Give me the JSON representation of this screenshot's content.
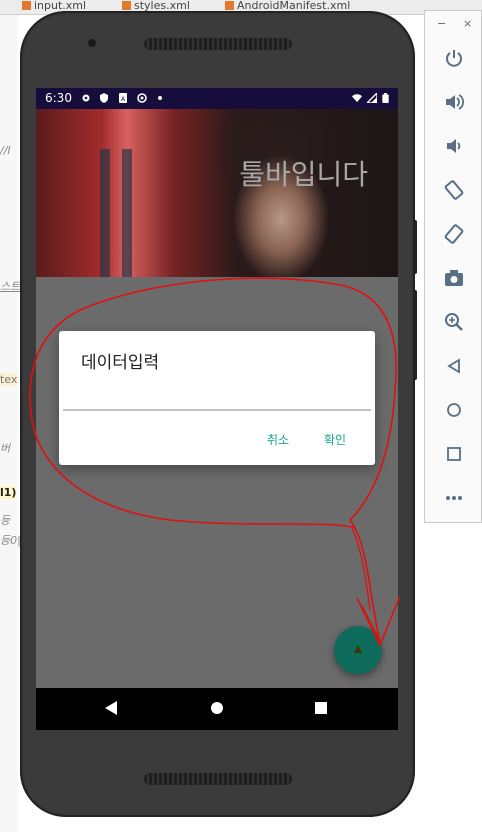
{
  "ide": {
    "tabs": [
      "input.xml",
      "styles.xml",
      "AndroidManifest.xml"
    ],
    "fragments": [
      "//I",
      "스트",
      "tex",
      "버",
      "l1)",
      "등",
      "등0|"
    ]
  },
  "emulator_toolbar": {
    "minimize": "−",
    "close": "×",
    "buttons": [
      "power-icon",
      "volume-up-icon",
      "volume-down-icon",
      "rotate-left-icon",
      "rotate-right-icon",
      "screenshot-icon",
      "zoom-icon",
      "back-icon",
      "home-icon",
      "overview-icon",
      "more-icon"
    ]
  },
  "phone": {
    "status_bar": {
      "time": "6:30"
    },
    "toolbar_title": "툴바입니다",
    "dialog": {
      "title": "데이터입력",
      "input_value": "",
      "cancel_label": "취소",
      "confirm_label": "확인"
    },
    "colors": {
      "status_bar": "#160d3c",
      "accent": "#14a892",
      "fab": "#0f6b5b",
      "annotation": "#e01010"
    }
  }
}
